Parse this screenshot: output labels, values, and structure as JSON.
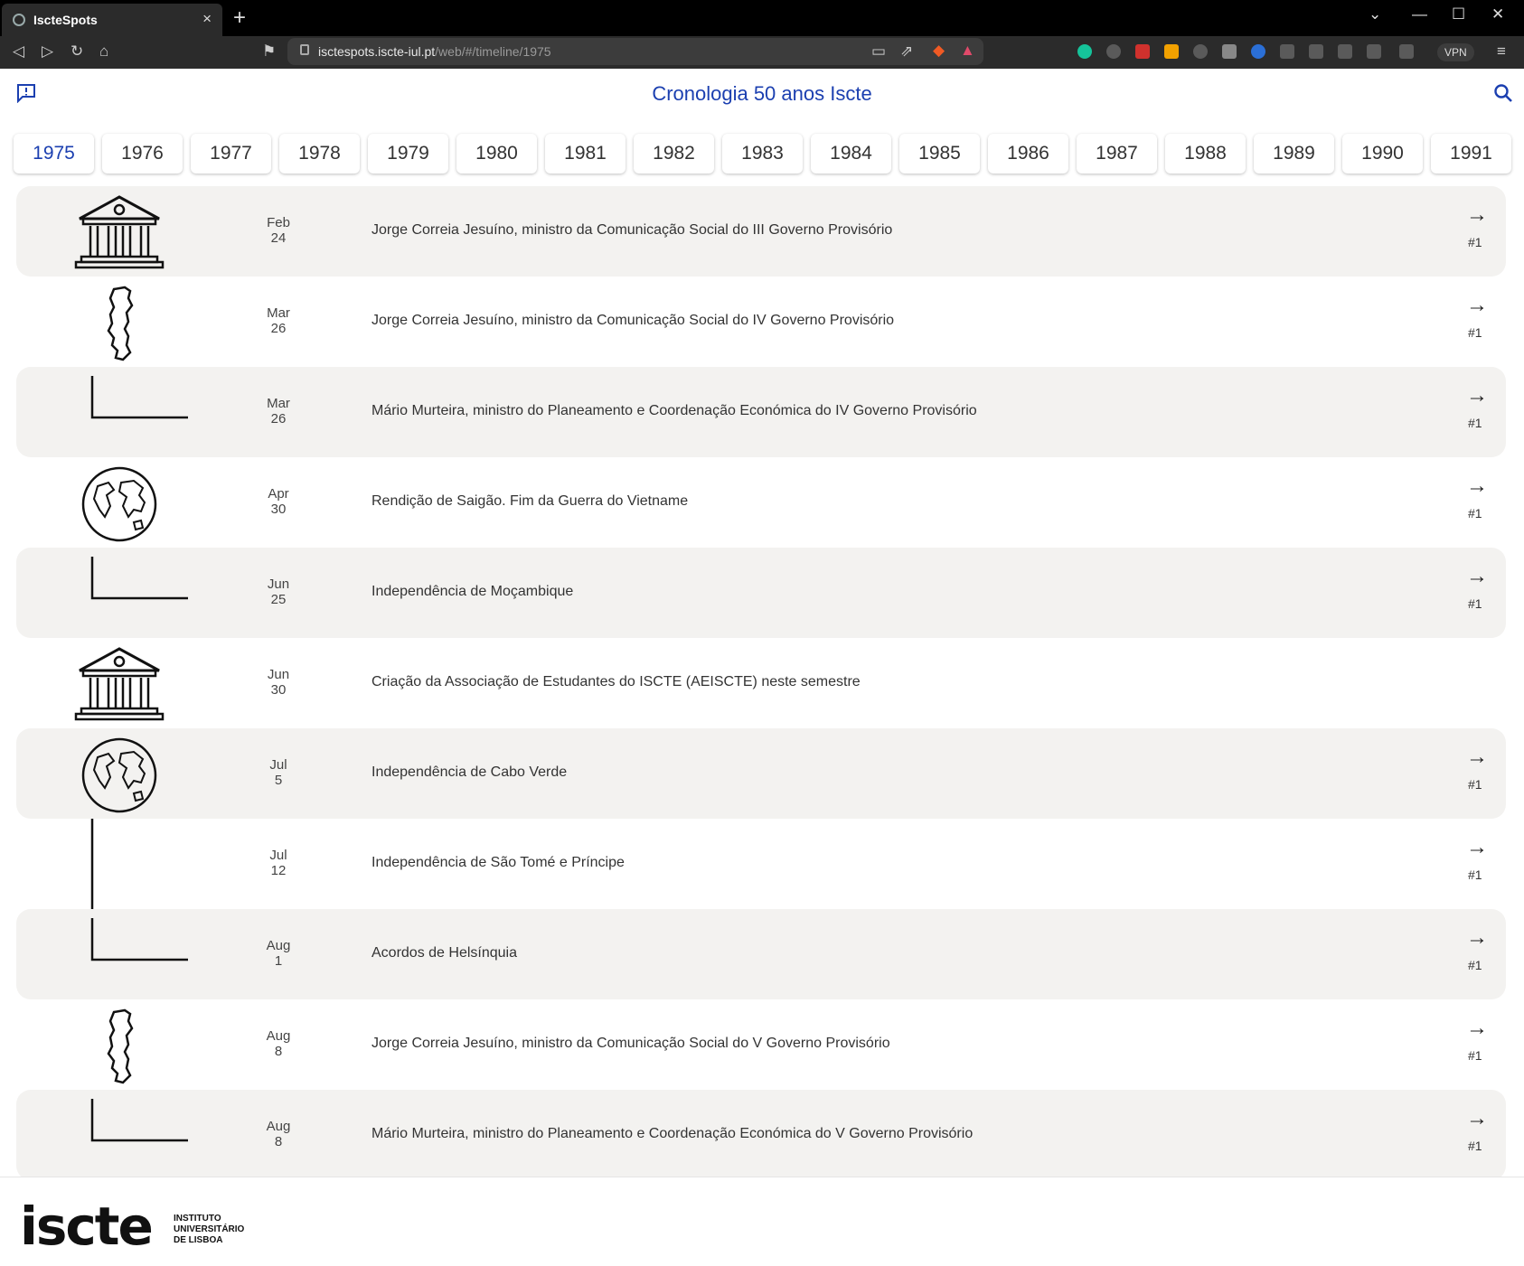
{
  "browser": {
    "tab_title": "IscteSpots",
    "tab_close": "×",
    "new_tab": "+",
    "url_host": "isctespots.iscte-iul.pt",
    "url_path": "/web/#/timeline/1975",
    "vpn_label": "VPN"
  },
  "header": {
    "title": "Cronologia 50 anos Iscte"
  },
  "years": [
    {
      "label": "1975",
      "active": true
    },
    {
      "label": "1976"
    },
    {
      "label": "1977"
    },
    {
      "label": "1978"
    },
    {
      "label": "1979"
    },
    {
      "label": "1980"
    },
    {
      "label": "1981"
    },
    {
      "label": "1982"
    },
    {
      "label": "1983"
    },
    {
      "label": "1984"
    },
    {
      "label": "1985"
    },
    {
      "label": "1986"
    },
    {
      "label": "1987"
    },
    {
      "label": "1988"
    },
    {
      "label": "1989"
    },
    {
      "label": "1990"
    },
    {
      "label": "1991"
    }
  ],
  "events": [
    {
      "month": "Feb",
      "day": "24",
      "text": "Jorge Correia Jesuíno, ministro da Comunicação Social do III Governo Provisório",
      "icon": "institution-icon",
      "link": "#1"
    },
    {
      "month": "Mar",
      "day": "26",
      "text": "Jorge Correia Jesuíno, ministro da Comunicação Social do IV Governo Provisório",
      "icon": "portugal-map-icon",
      "link": "#1"
    },
    {
      "month": "Mar",
      "day": "26",
      "text": "Mário Murteira, ministro do Planeamento e Coordenação Económica do IV Governo Provisório",
      "icon": "timeline-connector",
      "link": "#1"
    },
    {
      "month": "Apr",
      "day": "30",
      "text": "Rendição de Saigão. Fim da Guerra do Vietname",
      "icon": "globe-icon",
      "link": "#1"
    },
    {
      "month": "Jun",
      "day": "25",
      "text": "Independência de Moçambique",
      "icon": "timeline-connector",
      "link": "#1"
    },
    {
      "month": "Jun",
      "day": "30",
      "text": "Criação da Associação de Estudantes do ISCTE (AEISCTE) neste semestre",
      "icon": "institution-icon",
      "link": ""
    },
    {
      "month": "Jul",
      "day": "5",
      "text": "Independência de Cabo Verde",
      "icon": "globe-icon",
      "link": "#1"
    },
    {
      "month": "Jul",
      "day": "12",
      "text": "Independência de São Tomé e Príncipe",
      "icon": "timeline-line",
      "link": "#1"
    },
    {
      "month": "Aug",
      "day": "1",
      "text": "Acordos de Helsínquia",
      "icon": "timeline-connector",
      "link": "#1"
    },
    {
      "month": "Aug",
      "day": "8",
      "text": "Jorge Correia Jesuíno, ministro da Comunicação Social do V Governo Provisório",
      "icon": "portugal-map-icon",
      "link": "#1"
    },
    {
      "month": "Aug",
      "day": "8",
      "text": "Mário Murteira, ministro do Planeamento e Coordenação Económica do V Governo Provisório",
      "icon": "timeline-connector",
      "link": "#1"
    }
  ],
  "footer": {
    "logo": "iscte",
    "logo_sub_1": "INSTITUTO",
    "logo_sub_2": "UNIVERSITÁRIO",
    "logo_sub_3": "DE LISBOA"
  },
  "colors": {
    "accent": "#1b3fb0",
    "row_shade": "#f3f2f0"
  }
}
